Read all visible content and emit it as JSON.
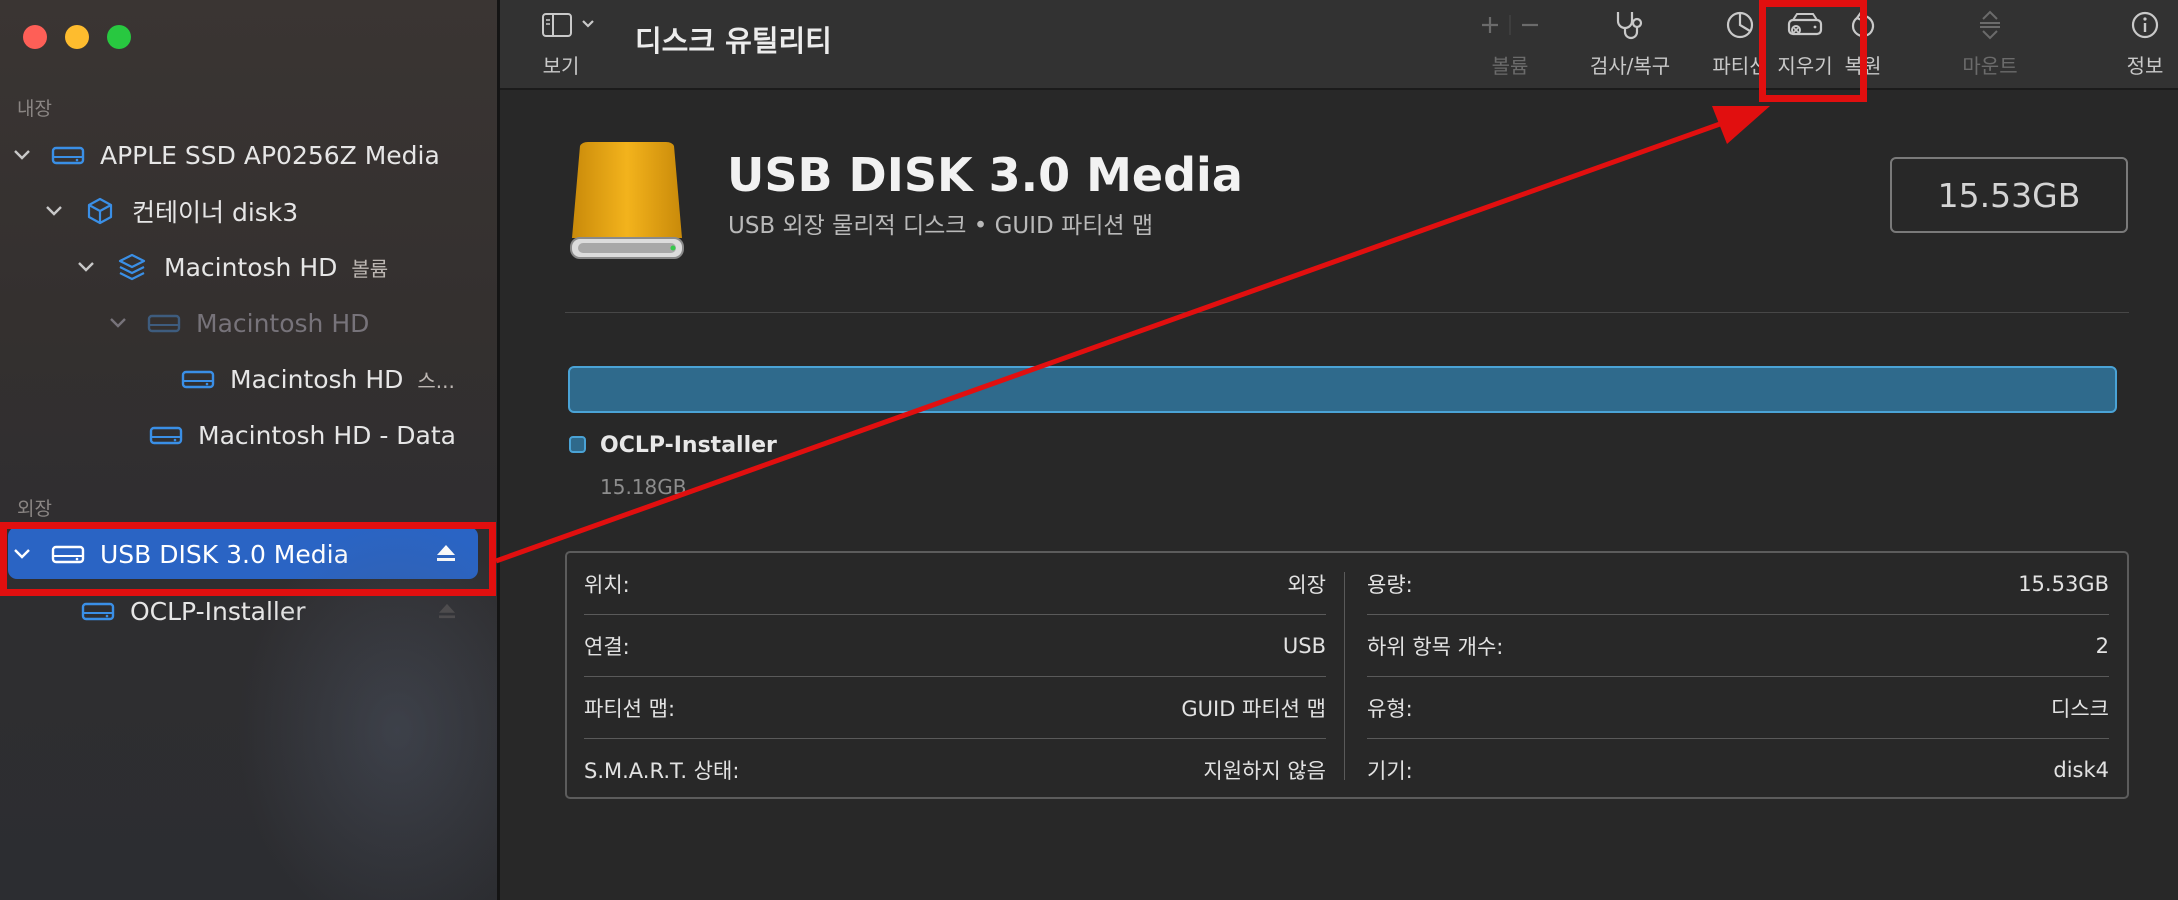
{
  "sidebar": {
    "section_internal": "내장",
    "section_external": "외장",
    "items": [
      {
        "label": "APPLE SSD AP0256Z Media",
        "sub": ""
      },
      {
        "label": "컨테이너 disk3",
        "sub": ""
      },
      {
        "label": "Macintosh HD",
        "sub": "볼륨"
      },
      {
        "label": "Macintosh HD",
        "sub": ""
      },
      {
        "label": "Macintosh HD",
        "sub": "스..."
      },
      {
        "label": "Macintosh HD - Data",
        "sub": ""
      },
      {
        "label": "USB DISK 3.0 Media",
        "sub": ""
      },
      {
        "label": "OCLP-Installer",
        "sub": ""
      }
    ]
  },
  "toolbar": {
    "title": "디스크 유틸리티",
    "view_label": "보기",
    "volume_label": "볼륨",
    "firstaid_label": "검사/복구",
    "partition_label": "파티션",
    "erase_label": "지우기",
    "restore_label": "복원",
    "mount_label": "마운트",
    "info_label": "정보"
  },
  "disk": {
    "name": "USB DISK 3.0 Media",
    "description": "USB 외장 물리적 디스크 • GUID 파티션 맵",
    "capacity": "15.53GB"
  },
  "partition": {
    "name": "OCLP-Installer",
    "size": "15.18GB",
    "color": "#2f6a8c"
  },
  "info": {
    "left": [
      {
        "key": "위치:",
        "value": "외장"
      },
      {
        "key": "연결:",
        "value": "USB"
      },
      {
        "key": "파티션 맵:",
        "value": "GUID 파티션 맵"
      },
      {
        "key": "S.M.A.R.T. 상태:",
        "value": "지원하지 않음"
      }
    ],
    "right": [
      {
        "key": "용량:",
        "value": "15.53GB"
      },
      {
        "key": "하위 항목 개수:",
        "value": "2"
      },
      {
        "key": "유형:",
        "value": "디스크"
      },
      {
        "key": "기기:",
        "value": "disk4"
      }
    ]
  },
  "colors": {
    "accent_selected": "#2a64c4",
    "annotation_red": "#e10f0f",
    "sidebar_icon_blue": "#3a8fe6"
  }
}
